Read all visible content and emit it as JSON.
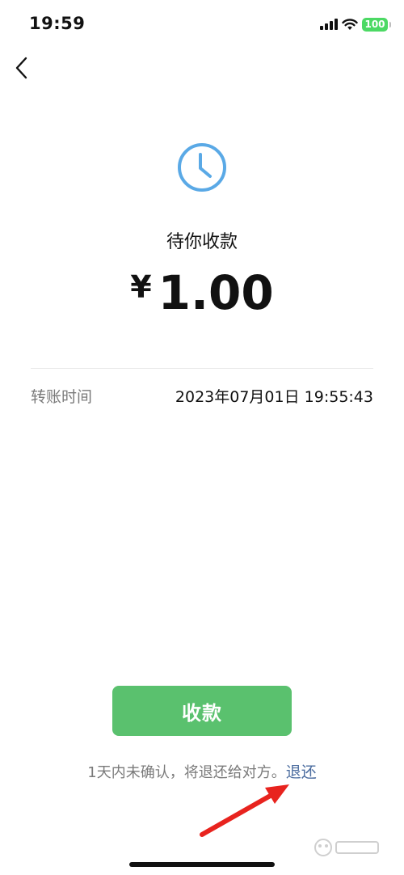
{
  "status_bar": {
    "time": "19:59",
    "battery": "100",
    "icons": [
      "signal-icon",
      "wifi-icon",
      "battery-icon"
    ]
  },
  "nav": {
    "back_icon": "chevron-left-icon"
  },
  "transfer": {
    "status_icon": "clock-icon",
    "status_title": "待你收款",
    "currency_symbol": "¥",
    "amount": "1.00",
    "time_label": "转账时间",
    "time_value": "2023年07月01日 19:55:43"
  },
  "actions": {
    "receive_label": "收款",
    "notice_text": "1天内未确认，将退还给对方。",
    "return_label": "退还"
  },
  "colors": {
    "accent_green": "#5ac16e",
    "link_blue": "#4b6c9f",
    "clock_blue": "#5aa9e6",
    "annotation_red": "#e8231e"
  }
}
